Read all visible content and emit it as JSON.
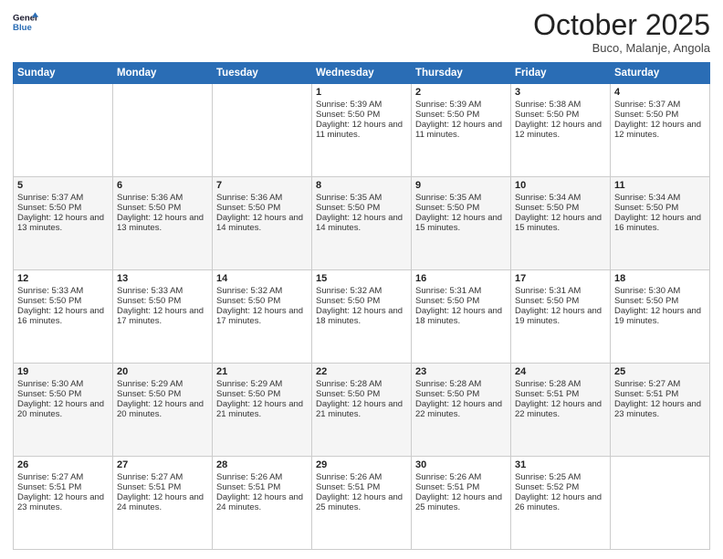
{
  "header": {
    "logo_line1": "General",
    "logo_line2": "Blue",
    "month_title": "October 2025",
    "location": "Buco, Malanje, Angola"
  },
  "days_of_week": [
    "Sunday",
    "Monday",
    "Tuesday",
    "Wednesday",
    "Thursday",
    "Friday",
    "Saturday"
  ],
  "weeks": [
    [
      {
        "day": "",
        "sunrise": "",
        "sunset": "",
        "daylight": ""
      },
      {
        "day": "",
        "sunrise": "",
        "sunset": "",
        "daylight": ""
      },
      {
        "day": "",
        "sunrise": "",
        "sunset": "",
        "daylight": ""
      },
      {
        "day": "1",
        "sunrise": "Sunrise: 5:39 AM",
        "sunset": "Sunset: 5:50 PM",
        "daylight": "Daylight: 12 hours and 11 minutes."
      },
      {
        "day": "2",
        "sunrise": "Sunrise: 5:39 AM",
        "sunset": "Sunset: 5:50 PM",
        "daylight": "Daylight: 12 hours and 11 minutes."
      },
      {
        "day": "3",
        "sunrise": "Sunrise: 5:38 AM",
        "sunset": "Sunset: 5:50 PM",
        "daylight": "Daylight: 12 hours and 12 minutes."
      },
      {
        "day": "4",
        "sunrise": "Sunrise: 5:37 AM",
        "sunset": "Sunset: 5:50 PM",
        "daylight": "Daylight: 12 hours and 12 minutes."
      }
    ],
    [
      {
        "day": "5",
        "sunrise": "Sunrise: 5:37 AM",
        "sunset": "Sunset: 5:50 PM",
        "daylight": "Daylight: 12 hours and 13 minutes."
      },
      {
        "day": "6",
        "sunrise": "Sunrise: 5:36 AM",
        "sunset": "Sunset: 5:50 PM",
        "daylight": "Daylight: 12 hours and 13 minutes."
      },
      {
        "day": "7",
        "sunrise": "Sunrise: 5:36 AM",
        "sunset": "Sunset: 5:50 PM",
        "daylight": "Daylight: 12 hours and 14 minutes."
      },
      {
        "day": "8",
        "sunrise": "Sunrise: 5:35 AM",
        "sunset": "Sunset: 5:50 PM",
        "daylight": "Daylight: 12 hours and 14 minutes."
      },
      {
        "day": "9",
        "sunrise": "Sunrise: 5:35 AM",
        "sunset": "Sunset: 5:50 PM",
        "daylight": "Daylight: 12 hours and 15 minutes."
      },
      {
        "day": "10",
        "sunrise": "Sunrise: 5:34 AM",
        "sunset": "Sunset: 5:50 PM",
        "daylight": "Daylight: 12 hours and 15 minutes."
      },
      {
        "day": "11",
        "sunrise": "Sunrise: 5:34 AM",
        "sunset": "Sunset: 5:50 PM",
        "daylight": "Daylight: 12 hours and 16 minutes."
      }
    ],
    [
      {
        "day": "12",
        "sunrise": "Sunrise: 5:33 AM",
        "sunset": "Sunset: 5:50 PM",
        "daylight": "Daylight: 12 hours and 16 minutes."
      },
      {
        "day": "13",
        "sunrise": "Sunrise: 5:33 AM",
        "sunset": "Sunset: 5:50 PM",
        "daylight": "Daylight: 12 hours and 17 minutes."
      },
      {
        "day": "14",
        "sunrise": "Sunrise: 5:32 AM",
        "sunset": "Sunset: 5:50 PM",
        "daylight": "Daylight: 12 hours and 17 minutes."
      },
      {
        "day": "15",
        "sunrise": "Sunrise: 5:32 AM",
        "sunset": "Sunset: 5:50 PM",
        "daylight": "Daylight: 12 hours and 18 minutes."
      },
      {
        "day": "16",
        "sunrise": "Sunrise: 5:31 AM",
        "sunset": "Sunset: 5:50 PM",
        "daylight": "Daylight: 12 hours and 18 minutes."
      },
      {
        "day": "17",
        "sunrise": "Sunrise: 5:31 AM",
        "sunset": "Sunset: 5:50 PM",
        "daylight": "Daylight: 12 hours and 19 minutes."
      },
      {
        "day": "18",
        "sunrise": "Sunrise: 5:30 AM",
        "sunset": "Sunset: 5:50 PM",
        "daylight": "Daylight: 12 hours and 19 minutes."
      }
    ],
    [
      {
        "day": "19",
        "sunrise": "Sunrise: 5:30 AM",
        "sunset": "Sunset: 5:50 PM",
        "daylight": "Daylight: 12 hours and 20 minutes."
      },
      {
        "day": "20",
        "sunrise": "Sunrise: 5:29 AM",
        "sunset": "Sunset: 5:50 PM",
        "daylight": "Daylight: 12 hours and 20 minutes."
      },
      {
        "day": "21",
        "sunrise": "Sunrise: 5:29 AM",
        "sunset": "Sunset: 5:50 PM",
        "daylight": "Daylight: 12 hours and 21 minutes."
      },
      {
        "day": "22",
        "sunrise": "Sunrise: 5:28 AM",
        "sunset": "Sunset: 5:50 PM",
        "daylight": "Daylight: 12 hours and 21 minutes."
      },
      {
        "day": "23",
        "sunrise": "Sunrise: 5:28 AM",
        "sunset": "Sunset: 5:50 PM",
        "daylight": "Daylight: 12 hours and 22 minutes."
      },
      {
        "day": "24",
        "sunrise": "Sunrise: 5:28 AM",
        "sunset": "Sunset: 5:51 PM",
        "daylight": "Daylight: 12 hours and 22 minutes."
      },
      {
        "day": "25",
        "sunrise": "Sunrise: 5:27 AM",
        "sunset": "Sunset: 5:51 PM",
        "daylight": "Daylight: 12 hours and 23 minutes."
      }
    ],
    [
      {
        "day": "26",
        "sunrise": "Sunrise: 5:27 AM",
        "sunset": "Sunset: 5:51 PM",
        "daylight": "Daylight: 12 hours and 23 minutes."
      },
      {
        "day": "27",
        "sunrise": "Sunrise: 5:27 AM",
        "sunset": "Sunset: 5:51 PM",
        "daylight": "Daylight: 12 hours and 24 minutes."
      },
      {
        "day": "28",
        "sunrise": "Sunrise: 5:26 AM",
        "sunset": "Sunset: 5:51 PM",
        "daylight": "Daylight: 12 hours and 24 minutes."
      },
      {
        "day": "29",
        "sunrise": "Sunrise: 5:26 AM",
        "sunset": "Sunset: 5:51 PM",
        "daylight": "Daylight: 12 hours and 25 minutes."
      },
      {
        "day": "30",
        "sunrise": "Sunrise: 5:26 AM",
        "sunset": "Sunset: 5:51 PM",
        "daylight": "Daylight: 12 hours and 25 minutes."
      },
      {
        "day": "31",
        "sunrise": "Sunrise: 5:25 AM",
        "sunset": "Sunset: 5:52 PM",
        "daylight": "Daylight: 12 hours and 26 minutes."
      },
      {
        "day": "",
        "sunrise": "",
        "sunset": "",
        "daylight": ""
      }
    ]
  ]
}
